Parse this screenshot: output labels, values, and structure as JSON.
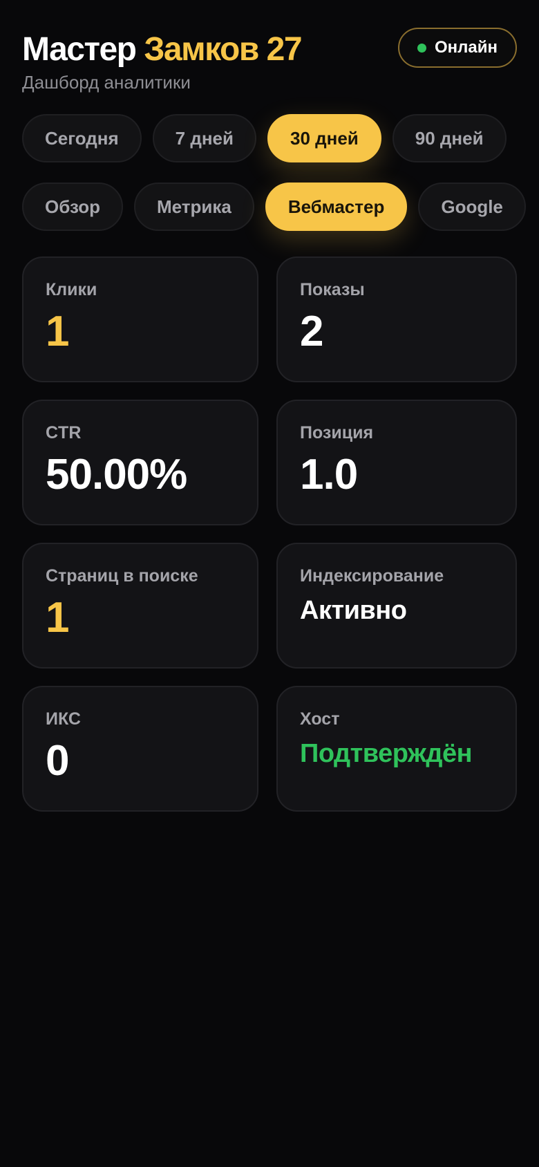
{
  "header": {
    "title_main": "Мастер",
    "title_accent": "Замков 27",
    "subtitle": "Дашборд аналитики",
    "status": "Онлайн"
  },
  "periods": [
    "Сегодня",
    "7 дней",
    "30 дней",
    "90 дней"
  ],
  "selected_period": "30 дней",
  "tabs": [
    "Обзор",
    "Метрика",
    "Вебмастер",
    "Google"
  ],
  "selected_tab": "Вебмастер",
  "cards": [
    {
      "label": "Клики",
      "value": "1",
      "tone": "gold"
    },
    {
      "label": "Показы",
      "value": "2",
      "tone": "white"
    },
    {
      "label": "CTR",
      "value": "50.00%",
      "tone": "white"
    },
    {
      "label": "Позиция",
      "value": "1.0",
      "tone": "white"
    },
    {
      "label": "Страниц в поиске",
      "value": "1",
      "tone": "gold"
    },
    {
      "label": "Индексирование",
      "value": "Активно",
      "tone": "white"
    },
    {
      "label": "ИКС",
      "value": "0",
      "tone": "white"
    },
    {
      "label": "Хост",
      "value": "Подтверждён",
      "tone": "green"
    }
  ],
  "colors": {
    "accent": "#f7c548",
    "success": "#2fc25b",
    "background": "#08080a",
    "card": "#131316"
  }
}
